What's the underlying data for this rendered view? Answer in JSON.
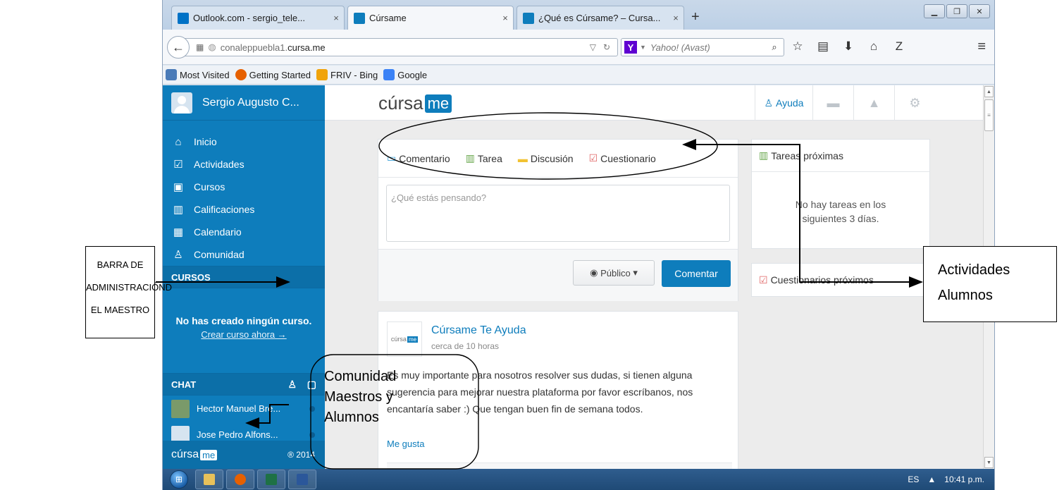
{
  "browser": {
    "tabs": [
      {
        "label": "Outlook.com - sergio_tele...",
        "close": "×",
        "favicon_color": "#0072c6"
      },
      {
        "label": "Cúrsame",
        "close": "×",
        "favicon_color": "#0e7dbc"
      },
      {
        "label": "¿Qué es Cúrsame? – Cursa...",
        "close": "×",
        "favicon_color": "#0e7dbc"
      }
    ],
    "new_tab": "+",
    "url_prefix": "conaleppuebla1.",
    "url_domain": "cursa.me",
    "search_placeholder": "Yahoo! (Avast)",
    "bookmarks": [
      {
        "label": "Most Visited",
        "color": "#4a7bb8"
      },
      {
        "label": "Getting Started",
        "color": "#e66000"
      },
      {
        "label": "FRIV - Bing",
        "color": "#f0a30a"
      },
      {
        "label": "Google",
        "color": "#3b82f6"
      }
    ]
  },
  "sidebar": {
    "user_name": "Sergio Augusto C...",
    "nav": [
      {
        "label": "Inicio",
        "icon": "⌂"
      },
      {
        "label": "Actividades",
        "icon": "☑"
      },
      {
        "label": "Cursos",
        "icon": "▣"
      },
      {
        "label": "Calificaciones",
        "icon": "▥"
      },
      {
        "label": "Calendario",
        "icon": "▦"
      },
      {
        "label": "Comunidad",
        "icon": "♙"
      }
    ],
    "cursos_header": "CURSOS",
    "empty_title": "No has creado ningún curso.",
    "empty_link": "Crear curso ahora →",
    "chat_header": "CHAT",
    "chat": [
      {
        "name": "Hector Manuel Bre...",
        "avatar_color": "#7a9a6a"
      },
      {
        "name": "Jose Pedro Alfons...",
        "avatar_color": "#d6e4f0"
      }
    ],
    "footer_logo": "cúrsa",
    "footer_logo_me": "me",
    "footer_year": "® 2014"
  },
  "header": {
    "brand": "cúrsa",
    "brand_me": "me",
    "help": "Ayuda"
  },
  "composer": {
    "tabs": [
      {
        "label": "Comentario",
        "icon": "💬",
        "color": "#3aa0d8"
      },
      {
        "label": "Tarea",
        "icon": "📗",
        "color": "#6aa84f"
      },
      {
        "label": "Discusión",
        "icon": "💭",
        "color": "#f1c232"
      },
      {
        "label": "Cuestionario",
        "icon": "☑",
        "color": "#e06666"
      }
    ],
    "placeholder": "¿Qué estás pensando?",
    "visibility": "Público",
    "submit": "Comentar"
  },
  "post": {
    "logo": "cúrsa",
    "logo_me": "me",
    "author": "Cúrsame Te Ayuda",
    "time": "cerca de 10 horas",
    "body": "Es muy importante para nosotros resolver sus dudas, si tienen alguna sugerencia para mejorar nuestra plataforma por favor escríbanos, nos encantaría saber :) Que tengan buen fin de semana todos.",
    "like": "Me gusta"
  },
  "right": {
    "tareas_title": "Tareas próximas",
    "tareas_empty": "No hay tareas en los siguientes 3 días.",
    "cuestionarios_title": "Cuestionarios próximos"
  },
  "taskbar": {
    "lang": "ES",
    "time": "10:41 p.m."
  },
  "annotations": {
    "left_l1": "BARRA DE",
    "left_l2": "ADMINISTRACIÓND",
    "left_l3": "EL MAESTRO",
    "right_l1": "Actividades",
    "right_l2": "Alumnos",
    "community_l1": "Comunidad",
    "community_l2": "Maestros  y",
    "community_l3": "Alumnos"
  }
}
